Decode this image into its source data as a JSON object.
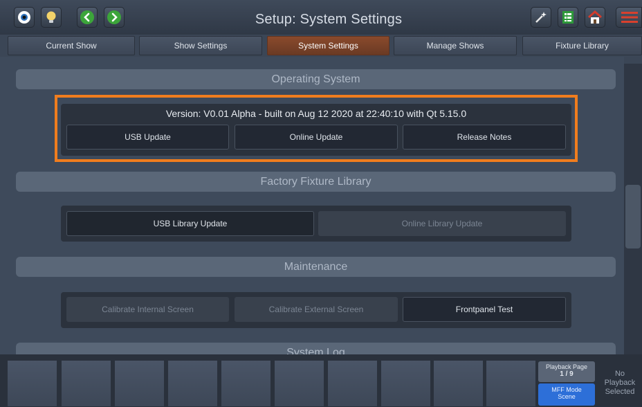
{
  "header": {
    "title": "Setup: System Settings",
    "left_buttons": [
      "eye-icon",
      "lightbulb-icon",
      "chevron-left-icon",
      "chevron-right-icon"
    ],
    "right_buttons": [
      "magic-wand-icon",
      "spreadsheet-icon",
      "home-icon",
      "menu-icon"
    ]
  },
  "tabs": [
    {
      "label": "Current Show",
      "active": false
    },
    {
      "label": "Show Settings",
      "active": false
    },
    {
      "label": "System Settings",
      "active": true
    },
    {
      "label": "Manage Shows",
      "active": false
    },
    {
      "label": "Fixture Library",
      "active": false
    }
  ],
  "operating_system": {
    "heading": "Operating System",
    "version_text": "Version: V0.01 Alpha - built on Aug 12 2020 at 22:40:10 with Qt 5.15.0",
    "usb_update": "USB Update",
    "online_update": "Online Update",
    "release_notes": "Release Notes"
  },
  "factory_fixture_library": {
    "heading": "Factory Fixture Library",
    "usb_library_update": "USB Library Update",
    "online_library_update": "Online Library Update"
  },
  "maintenance": {
    "heading": "Maintenance",
    "calibrate_internal": "Calibrate Internal Screen",
    "calibrate_external": "Calibrate External Screen",
    "frontpanel_test": "Frontpanel Test"
  },
  "system_log": {
    "heading": "System Log"
  },
  "playback": {
    "page_label": "Playback Page",
    "page_value": "1 / 9",
    "mff_label": "MFF Mode",
    "mff_value": "Scene",
    "status_line1": "No",
    "status_line2": "Playback",
    "status_line3": "Selected"
  },
  "colors": {
    "accent": "#f07d1e",
    "active_tab": "#7a4228",
    "mff_blue": "#2d6fd8",
    "background": "#3e4a5b"
  }
}
